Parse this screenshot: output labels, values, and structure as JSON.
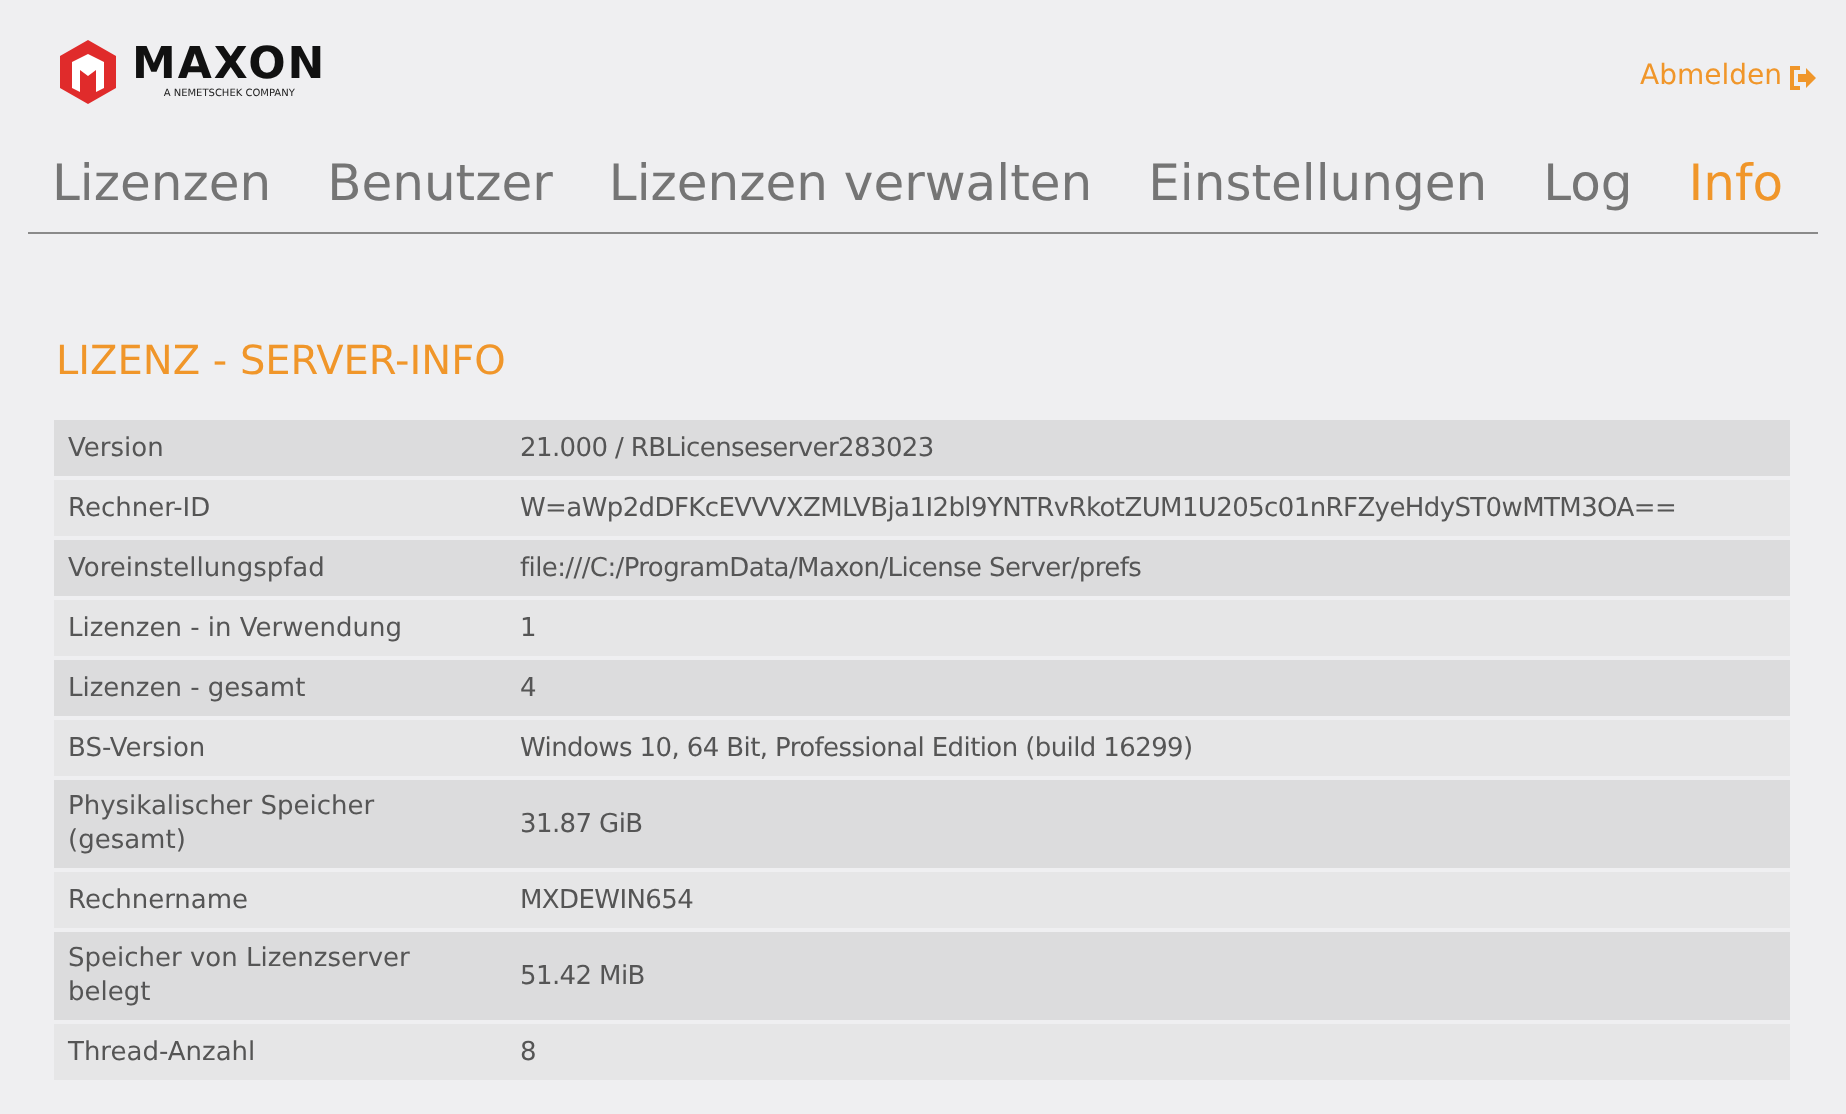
{
  "logo": {
    "name": "MAXON",
    "tagline": "A NEMETSCHEK COMPANY"
  },
  "logout": {
    "label": "Abmelden"
  },
  "tabs": [
    {
      "label": "Lizenzen",
      "selected": false
    },
    {
      "label": "Benutzer",
      "selected": false
    },
    {
      "label": "Lizenzen verwalten",
      "selected": false
    },
    {
      "label": "Einstellungen",
      "selected": false
    },
    {
      "label": "Log",
      "selected": false
    },
    {
      "label": "Info",
      "selected": true
    }
  ],
  "heading": "LIZENZ - SERVER-INFO",
  "info_rows": [
    {
      "label": "Version",
      "value": "21.000 / RBLicenseserver283023"
    },
    {
      "label": "Rechner-ID",
      "value": "W=aWp2dDFKcEVVVXZMLVBja1I2bl9YNTRvRkotZUM1U205c01nRFZyeHdyST0wMTM3OA=="
    },
    {
      "label": "Voreinstellungspfad",
      "value": "file:///C:/ProgramData/Maxon/License Server/prefs"
    },
    {
      "label": "Lizenzen - in Verwendung",
      "value": "1"
    },
    {
      "label": "Lizenzen - gesamt",
      "value": "4"
    },
    {
      "label": "BS-Version",
      "value": "Windows 10, 64 Bit, Professional Edition (build 16299)"
    },
    {
      "label": "Physikalischer Speicher (gesamt)",
      "value": "31.87 GiB"
    },
    {
      "label": "Rechnername",
      "value": "MXDEWIN654"
    },
    {
      "label": "Speicher von Lizenzserver belegt",
      "value": "51.42 MiB"
    },
    {
      "label": "Thread-Anzahl",
      "value": "8"
    }
  ]
}
